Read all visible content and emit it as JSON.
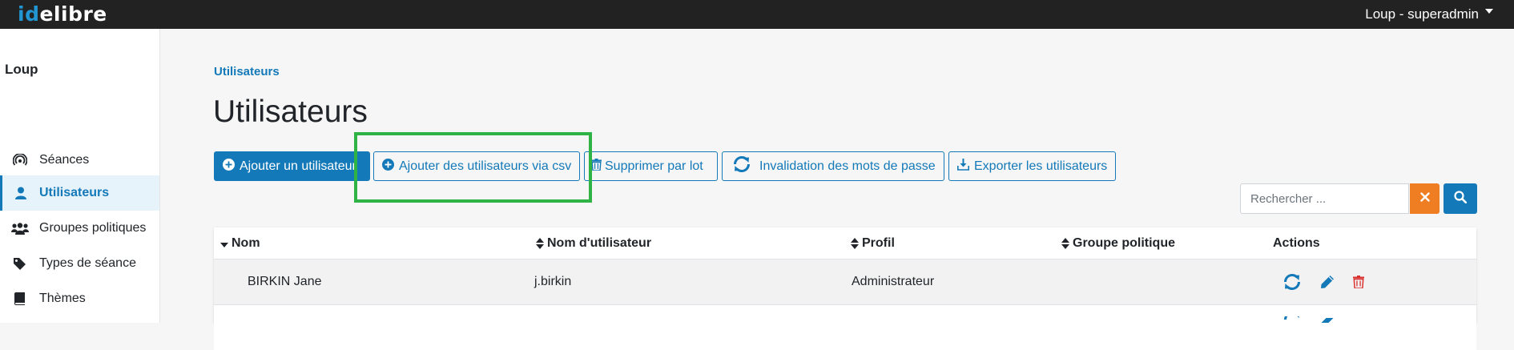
{
  "app": {
    "logo_prefix": "id",
    "logo_suffix": "elibre",
    "user_menu_label": "Loup - superadmin"
  },
  "sidebar": {
    "title": "Loup",
    "items": [
      {
        "label": "Séances",
        "icon": "podcast-icon"
      },
      {
        "label": "Utilisateurs",
        "icon": "user-icon",
        "active": true
      },
      {
        "label": "Groupes politiques",
        "icon": "users-group-icon"
      },
      {
        "label": "Types de séance",
        "icon": "tag-icon"
      },
      {
        "label": "Thèmes",
        "icon": "book-icon"
      }
    ]
  },
  "main": {
    "breadcrumb": "Utilisateurs",
    "title": "Utilisateurs",
    "buttons": {
      "add_user": "Ajouter un utilisateur",
      "add_csv": "Ajouter des utilisateurs via csv",
      "delete_batch": "Supprimer par lot",
      "invalidate_passwords": "Invalidation des mots de passe",
      "export_users": "Exporter les utilisateurs"
    },
    "search": {
      "placeholder": "Rechercher ...",
      "value": ""
    }
  },
  "table": {
    "columns": [
      "Nom",
      "Nom d'utilisateur",
      "Profil",
      "Groupe politique",
      "Actions"
    ],
    "rows": [
      {
        "name": "BIRKIN Jane",
        "username": "j.birkin",
        "profile": "Administrateur",
        "group": ""
      }
    ]
  },
  "colors": {
    "primary": "#1479b8",
    "danger": "#d9312f",
    "warning": "#ef7d22",
    "highlight": "#2fb345",
    "navbar": "#222222"
  }
}
